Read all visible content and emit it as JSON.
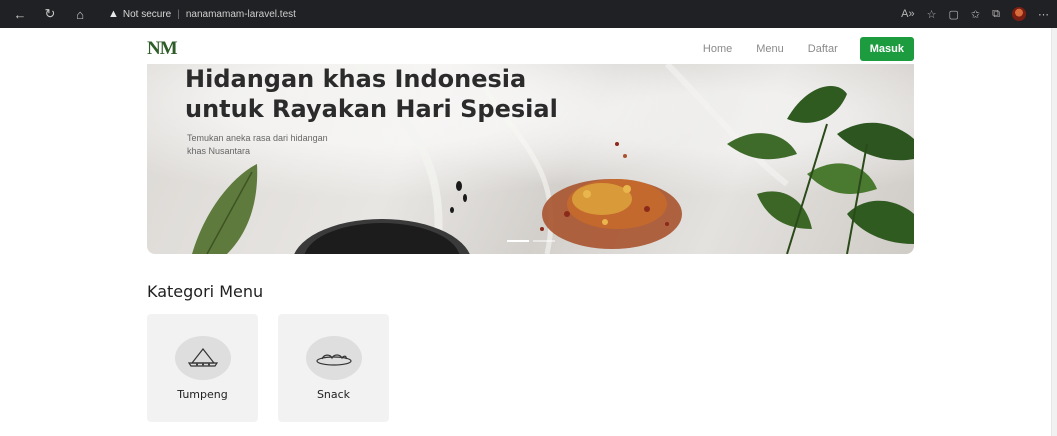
{
  "browser": {
    "security_label": "Not secure",
    "url": "nanamamam-laravel.test"
  },
  "navbar": {
    "logo": "NM",
    "links": [
      "Home",
      "Menu",
      "Daftar"
    ],
    "login_button": "Masuk"
  },
  "hero": {
    "title_line1": "Hidangan khas Indonesia",
    "title_line2": "untuk Rayakan Hari Spesial",
    "subtitle_line1": "Temukan aneka rasa dari hidangan",
    "subtitle_line2": "khas Nusantara"
  },
  "kategori": {
    "title": "Kategori Menu",
    "items": [
      {
        "label": "Tumpeng",
        "icon": "tumpeng-icon"
      },
      {
        "label": "Snack",
        "icon": "snack-icon"
      }
    ]
  },
  "colors": {
    "accent": "#1c9c3f",
    "logo": "#2f5d2a"
  }
}
